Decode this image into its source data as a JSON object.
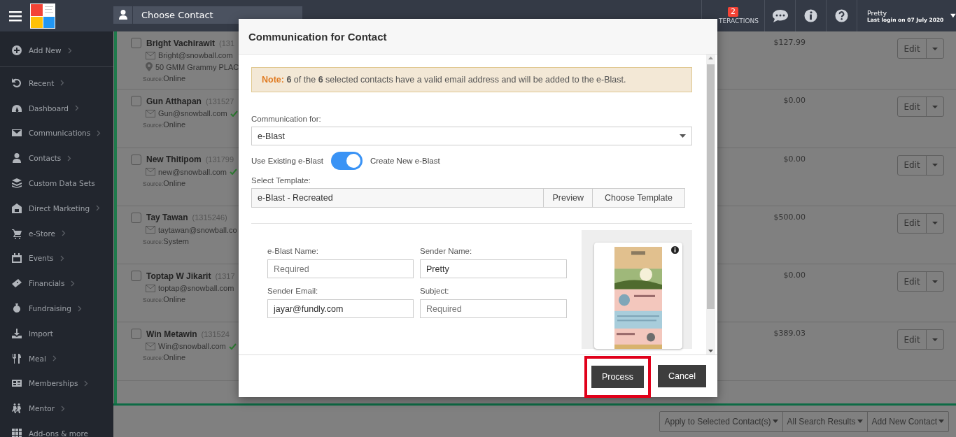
{
  "header": {
    "contact_search": {
      "placeholder": "Choose Contact"
    },
    "interactions": {
      "count": "2",
      "label": "TERACTIONS"
    },
    "user": {
      "name": "Pretty",
      "last_login": "Last login on 07 July 2020"
    }
  },
  "sidebar": {
    "items": [
      {
        "label": "Add New",
        "arrow": true
      },
      {
        "label": "Recent",
        "arrow": true
      },
      {
        "label": "Dashboard",
        "arrow": true
      },
      {
        "label": "Communications",
        "arrow": true
      },
      {
        "label": "Contacts",
        "arrow": true
      },
      {
        "label": "Custom Data Sets",
        "arrow": false
      },
      {
        "label": "Direct Marketing",
        "arrow": true
      },
      {
        "label": "e-Store",
        "arrow": true
      },
      {
        "label": "Events",
        "arrow": true
      },
      {
        "label": "Financials",
        "arrow": true
      },
      {
        "label": "Fundraising",
        "arrow": true
      },
      {
        "label": "Import",
        "arrow": false
      },
      {
        "label": "Meal",
        "arrow": true
      },
      {
        "label": "Memberships",
        "arrow": true
      },
      {
        "label": "Mentor",
        "arrow": true
      },
      {
        "label": "Add-ons & more",
        "arrow": false
      }
    ]
  },
  "contacts": [
    {
      "checked": false,
      "name": "Bright Vachirawit",
      "id": "(131",
      "email": "Bright@snowball.com",
      "verified": false,
      "address": "50 GMM Grammy PLAC",
      "source_label": "Source:",
      "source": "Online",
      "amount": "$127.99",
      "action": "Edit"
    },
    {
      "checked": false,
      "name": "Gun Atthapan",
      "id": "(131527",
      "email": "Gun@snowball.com",
      "verified": true,
      "source_label": "Source:",
      "source": "Online",
      "amount": "$0.00",
      "action": "Edit"
    },
    {
      "checked": false,
      "name": "New Thitipom",
      "id": "(131799",
      "email": "new@snowball.com",
      "verified": true,
      "source_label": "Source:",
      "source": "Online",
      "amount": "$0.00",
      "action": "Edit"
    },
    {
      "checked": false,
      "name": "Tay Tawan",
      "id": "(1315246)",
      "email": "taytawan@snowball.co",
      "verified": false,
      "source_label": "Source:",
      "source": "System",
      "amount": "$500.00",
      "action": "Edit"
    },
    {
      "checked": false,
      "name": "Toptap W Jikarit",
      "id": "(1317",
      "email": "toptap@snowball.com",
      "verified": false,
      "source_label": "Source:",
      "source": "Online",
      "amount": "$0.00",
      "action": "Edit"
    },
    {
      "checked": false,
      "name": "Win Metawin",
      "id": "(131524",
      "email": "Win@snowball.com",
      "verified": true,
      "source_label": "Source:",
      "source": "Online",
      "amount": "$389.03",
      "action": "Edit"
    }
  ],
  "bottom_bar": {
    "buttons": [
      "Apply to Selected Contact(s)",
      "All Search Results",
      "Add New Contact"
    ]
  },
  "modal": {
    "title": "Communication for Contact",
    "note": {
      "label": "Note:",
      "text": "**6** of the **6** selected contacts have a valid email address and will be added to the e-Blast."
    },
    "communication_for": {
      "label": "Communication for:",
      "value": "e-Blast"
    },
    "toggle": {
      "left_label": "Use Existing e-Blast",
      "right_label": "Create New e-Blast",
      "on": true
    },
    "template": {
      "label": "Select Template:",
      "value": "e-Blast - Recreated",
      "buttons": [
        "Preview",
        "Choose Template"
      ]
    },
    "fields": [
      {
        "label": "e-Blast Name:",
        "placeholder": "Required"
      },
      {
        "label": "Sender Name:",
        "value": "Pretty"
      },
      {
        "label": "Sender Email:",
        "value": "jayar@fundly.com"
      },
      {
        "label": "Subject:",
        "placeholder": "Required"
      }
    ],
    "footer_buttons": [
      {
        "label": "Process",
        "highlighted": true
      },
      {
        "label": "Cancel",
        "highlighted": false
      }
    ]
  }
}
